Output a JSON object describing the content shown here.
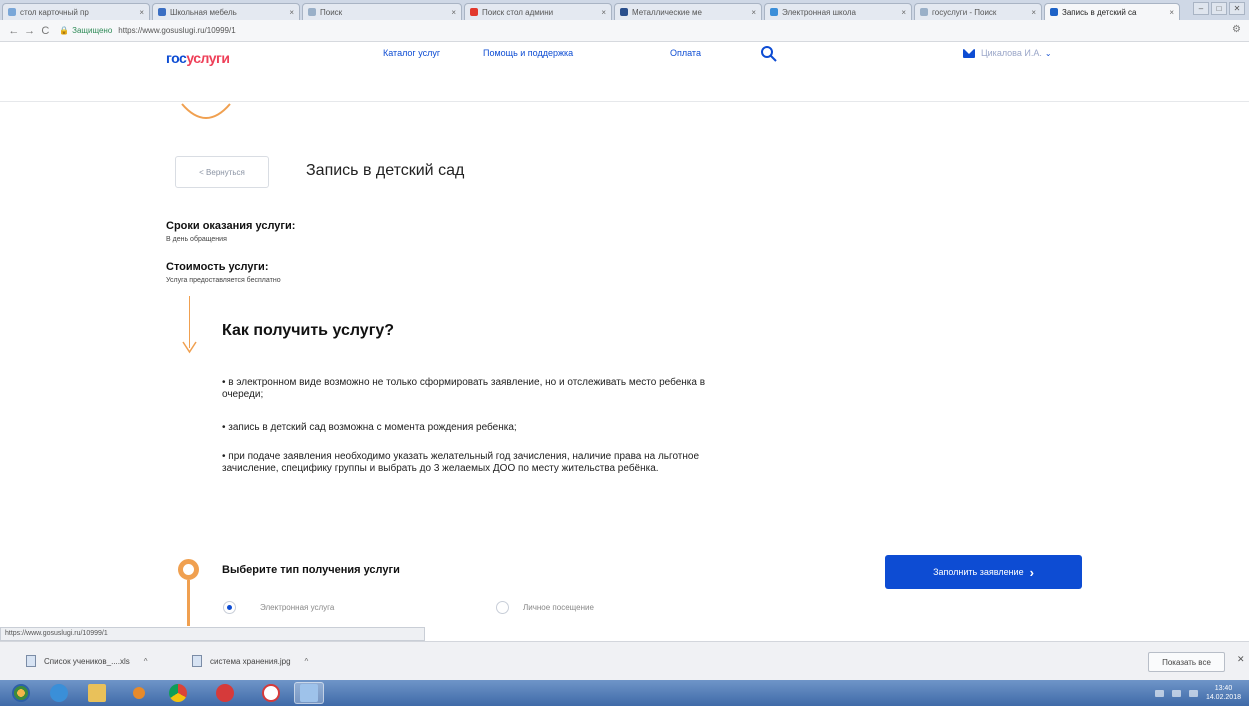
{
  "browser": {
    "tabs": [
      {
        "label": "стол карточный пр",
        "color": "#7aa7d8"
      },
      {
        "label": "Школьная мебель",
        "color": "#3b6fc3"
      },
      {
        "label": "Поиск",
        "color": "#9ab0c8"
      },
      {
        "label": "Поиск стол админи",
        "color": "#e2392d"
      },
      {
        "label": "Металлические ме",
        "color": "#2a4f8c"
      },
      {
        "label": "Электронная школа",
        "color": "#3c8fd9"
      },
      {
        "label": "госуслуги - Поиск",
        "color": "#9ab0c8"
      },
      {
        "label": "Запись в детский са",
        "color": "#1e63c7",
        "active": true
      }
    ],
    "secure_label": "Защищено",
    "url": "https://www.gosuslugi.ru/10999/1"
  },
  "site": {
    "logo_part1": "гос",
    "logo_part2": "услуги",
    "nav": [
      "Каталог услуг",
      "Помощь и поддержка",
      "Оплата"
    ],
    "user_name": "Цикалова И.А."
  },
  "main": {
    "back_label": "< Вернуться",
    "title": "Запись в детский сад",
    "terms_heading": "Сроки оказания услуги:",
    "terms_text": "В день обращения",
    "cost_heading": "Стоимость услуги:",
    "cost_text": "Услуга предоставляется бесплатно",
    "how_title": "Как получить услугу?",
    "bullets": [
      "• в электронном виде возможно не только сформировать заявление, но и отслеживать место ребенка в очереди;",
      "• запись в детский сад возможна с момента рождения ребенка;",
      "• при подаче заявления необходимо указать желательный год зачисления, наличие права на льготное зачисление, специфику группы и выбрать до 3 желаемых ДОО по месту жительства ребёнка."
    ],
    "step_title": "Выберите тип получения услуги",
    "option_electronic": "Электронная услуга",
    "option_visit": "Личное посещение",
    "fill_button": "Заполнить заявление"
  },
  "status_url": "https://www.gosuslugi.ru/10999/1",
  "downloads": {
    "items": [
      "Список учеников_....xls",
      "система хранения.jpg"
    ],
    "show_all": "Показать все"
  },
  "taskbar": {
    "time": "13:40",
    "date": "14.02.2018"
  },
  "colors": {
    "accent": "#0d4cd3",
    "brand_red": "#ee3f58",
    "orange": "#f0a050"
  }
}
